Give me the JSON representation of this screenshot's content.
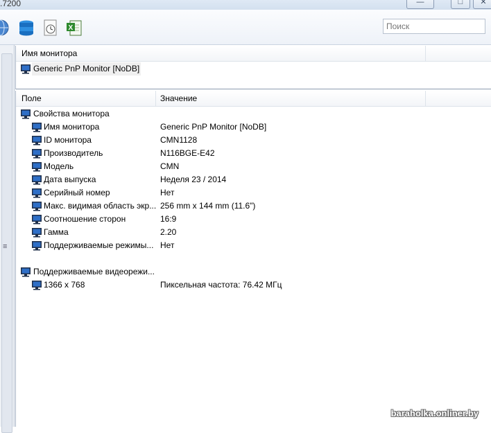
{
  "window": {
    "title": ".7200",
    "controls": {
      "minimize": "—",
      "maximize": "□",
      "close": "✕"
    }
  },
  "toolbar": {
    "icons": [
      "globe-icon",
      "database-icon",
      "report-clock-icon",
      "excel-export-icon"
    ],
    "search_placeholder": "Поиск"
  },
  "top_pane": {
    "header": "Имя монитора",
    "items": [
      {
        "label": "Generic PnP Monitor [NoDB]",
        "icon": "monitor-icon"
      }
    ]
  },
  "bottom_pane": {
    "headers": {
      "field": "Поле",
      "value": "Значение"
    },
    "groups": [
      {
        "title": "Свойства монитора",
        "rows": [
          {
            "field": "Имя монитора",
            "value": "Generic PnP Monitor [NoDB]"
          },
          {
            "field": "ID монитора",
            "value": "CMN1128"
          },
          {
            "field": "Производитель",
            "value": "N116BGE-E42"
          },
          {
            "field": "Модель",
            "value": "CMN"
          },
          {
            "field": "Дата выпуска",
            "value": "Неделя 23 / 2014"
          },
          {
            "field": "Серийный номер",
            "value": "Нет"
          },
          {
            "field": "Макс. видимая область экр...",
            "value": "256 mm x 144 mm (11.6\")"
          },
          {
            "field": "Соотношение сторон",
            "value": "16:9"
          },
          {
            "field": "Гамма",
            "value": "2.20"
          },
          {
            "field": "Поддерживаемые режимы...",
            "value": "Нет"
          }
        ]
      },
      {
        "title": "Поддерживаемые видеорежи...",
        "rows": [
          {
            "field": "1366 x 768",
            "value": "Пиксельная частота: 76.42 МГц"
          }
        ]
      }
    ]
  },
  "gutter": {
    "grip": "≡"
  },
  "watermark": "baraholka.onliner.by",
  "colors": {
    "monitor_frame": "#1f2f4a",
    "monitor_screen": "#2f6fc7",
    "selection": "#f0f0f0"
  }
}
